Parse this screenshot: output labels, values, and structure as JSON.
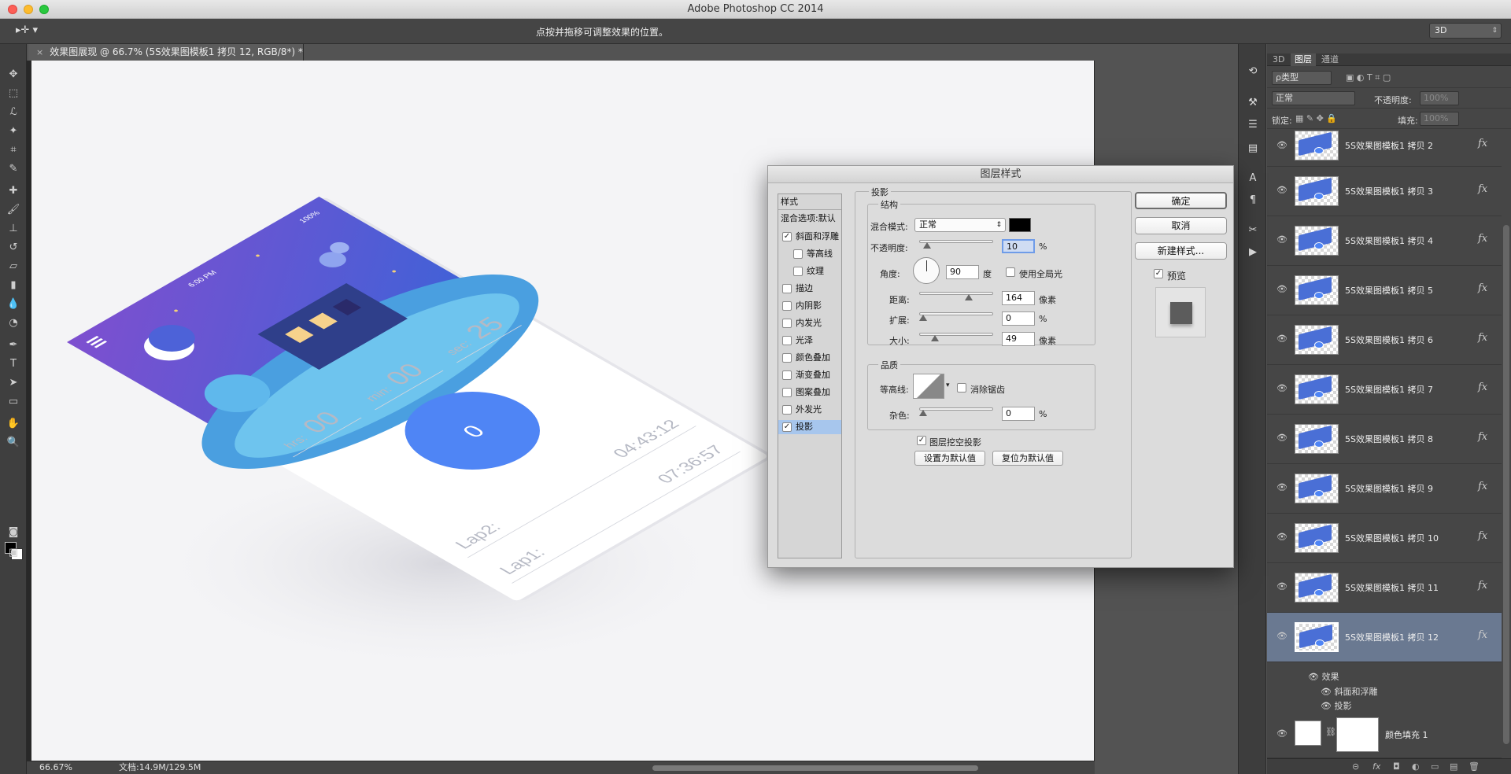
{
  "app_title": "Adobe Photoshop CC 2014",
  "options_bar": {
    "tool_glyph": "▸✛ ▾",
    "hint": "点按并拖移可调整效果的位置。",
    "mode": "3D"
  },
  "document": {
    "tab_title": "效果图展现 @ 66.7% (5S效果图模板1 拷贝 12, RGB/8*) *",
    "close_glyph": "×"
  },
  "status": {
    "zoom": "66.67%",
    "doc_size": "文档:14.9M/129.5M"
  },
  "phone_screen": {
    "status_time": "6:00 PM",
    "battery": "100%",
    "hrs_label": "hrs:",
    "hrs_value": "00",
    "min_label": "min:",
    "min_value": "00",
    "sec_label": "sec:",
    "sec_value": "25",
    "button_value": "0",
    "lap2_label": "Lap2:",
    "lap2_time": "04:43:12",
    "lap1_label": "Lap1:",
    "lap1_time": "07:36:57",
    "colors": {
      "primary": "#4f85f5",
      "sky_top": "#7e4fcf",
      "sky_bottom": "#3b63d8",
      "hill": "#4a9fe0"
    }
  },
  "panel": {
    "tabs": [
      "3D",
      "图层",
      "通道"
    ],
    "filter_type": "ρ类型",
    "blend_mode": "正常",
    "opacity_label": "不透明度:",
    "opacity_value": "100%",
    "lock_label": "锁定:",
    "fill_label": "填充:",
    "fill_value": "100%",
    "layers": [
      {
        "name": "5S效果图模板1 拷贝 2"
      },
      {
        "name": "5S效果图模板1 拷贝 3"
      },
      {
        "name": "5S效果图模板1 拷贝 4"
      },
      {
        "name": "5S效果图模板1 拷贝 5"
      },
      {
        "name": "5S效果图模板1 拷贝 6"
      },
      {
        "name": "5S效果图模板1 拷贝 7"
      },
      {
        "name": "5S效果图模板1 拷贝 8"
      },
      {
        "name": "5S效果图模板1 拷贝 9"
      },
      {
        "name": "5S效果图模板1 拷贝 10"
      },
      {
        "name": "5S效果图模板1 拷贝 11"
      },
      {
        "name": "5S效果图模板1 拷贝 12"
      }
    ],
    "fx_label": "fx",
    "effects_title": "效果",
    "effects": [
      "斜面和浮雕",
      "投影"
    ],
    "fill_layer_name": "颜色填充 1",
    "bottom_icons": [
      "⊝",
      "fx",
      "◘",
      "◐",
      "▭",
      "▤",
      "🗑"
    ]
  },
  "dialog": {
    "title": "图层样式",
    "styles_header": "样式",
    "blend_options": "混合选项:默认",
    "style_items": [
      {
        "label": "斜面和浮雕",
        "checked": true
      },
      {
        "label": "等高线",
        "checked": false
      },
      {
        "label": "纹理",
        "checked": false
      },
      {
        "label": "描边",
        "checked": false
      },
      {
        "label": "内阴影",
        "checked": false
      },
      {
        "label": "内发光",
        "checked": false
      },
      {
        "label": "光泽",
        "checked": false
      },
      {
        "label": "颜色叠加",
        "checked": false
      },
      {
        "label": "渐变叠加",
        "checked": false
      },
      {
        "label": "图案叠加",
        "checked": false
      },
      {
        "label": "外发光",
        "checked": false
      },
      {
        "label": "投影",
        "checked": true
      }
    ],
    "section_title": "投影",
    "structure_title": "结构",
    "blend_mode_label": "混合模式:",
    "blend_mode_value": "正常",
    "shadow_color": "#000000",
    "opacity_label": "不透明度:",
    "opacity_value": "10",
    "opacity_fraction": 0.1,
    "angle_label": "角度:",
    "angle_value": "90",
    "angle_unit": "度",
    "global_light_label": "使用全局光",
    "distance_label": "距离:",
    "distance_value": "164",
    "distance_fraction": 0.66,
    "spread_label": "扩展:",
    "spread_value": "0",
    "size_label": "大小:",
    "size_value": "49",
    "size_fraction": 0.2,
    "percent": "%",
    "pixels": "像素",
    "quality_title": "品质",
    "contour_label": "等高线:",
    "antialias_label": "消除锯齿",
    "noise_label": "杂色:",
    "noise_value": "0",
    "knockout_label": "图层挖空投影",
    "make_default_button": "设置为默认值",
    "reset_default_button": "复位为默认值",
    "ok_button": "确定",
    "cancel_button": "取消",
    "new_style_button": "新建样式...",
    "preview_label": "预览"
  }
}
